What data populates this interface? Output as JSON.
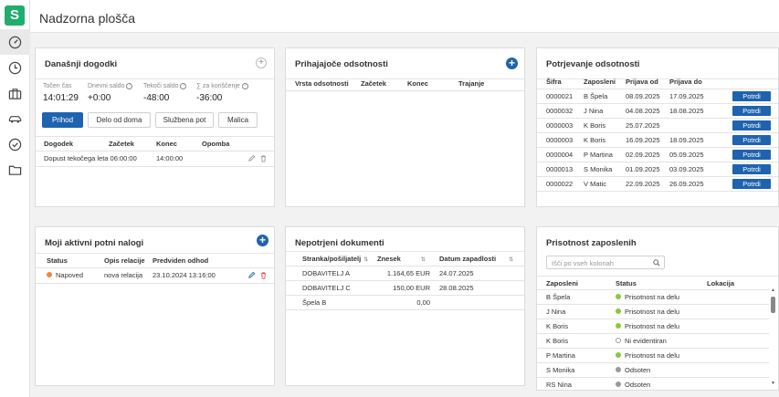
{
  "app": {
    "logo_letter": "S",
    "title": "Nadzorna plošča",
    "nav": [
      "dashboard-icon",
      "clock-icon",
      "briefcase-icon",
      "car-icon",
      "check-circle-icon",
      "folder-icon"
    ]
  },
  "todays_events": {
    "title": "Današnji dogodki",
    "stats": [
      {
        "label": "Točen čas",
        "value": "14:01:29"
      },
      {
        "label": "Dnevni saldo",
        "value": "+0:00"
      },
      {
        "label": "Tekoči saldo",
        "value": "-48:00"
      },
      {
        "label": "∑ za koriščenje",
        "value": "-36:00"
      }
    ],
    "buttons": [
      "Prihod",
      "Delo od doma",
      "Službena pot",
      "Malica"
    ],
    "columns": [
      "Dogodek",
      "Začetek",
      "Konec",
      "Opomba"
    ],
    "rows": [
      {
        "dogodek": "Dopust tekočega leta 06:00:00",
        "zacetek": "",
        "konec": "14:00:00",
        "opomba": ""
      }
    ]
  },
  "incoming_absences": {
    "title": "Prihajajoče odsotnosti",
    "columns": [
      "Vrsta odsotnosti",
      "Začetek",
      "Konec",
      "Trajanje"
    ]
  },
  "absence_confirmation": {
    "title": "Potrjevanje odsotnosti",
    "columns": [
      "Šifra",
      "Zaposleni",
      "Prijava od",
      "Prijava do"
    ],
    "button_label": "Potrdi",
    "rows": [
      {
        "sifra": "0000021",
        "zaposleni": "B Špela",
        "od": "08.09.2025",
        "do": "17.09.2025"
      },
      {
        "sifra": "0000032",
        "zaposleni": "J Nina",
        "od": "04.08.2025",
        "do": "18.08.2025"
      },
      {
        "sifra": "0000003",
        "zaposleni": "K Boris",
        "od": "25.07.2025",
        "do": ""
      },
      {
        "sifra": "0000003",
        "zaposleni": "K Boris",
        "od": "16.09.2025",
        "do": "18.09.2025"
      },
      {
        "sifra": "0000004",
        "zaposleni": "P Martina",
        "od": "02.09.2025",
        "do": "05.09.2025"
      },
      {
        "sifra": "0000013",
        "zaposleni": "S Monika",
        "od": "01.09.2025",
        "do": "03.09.2025"
      },
      {
        "sifra": "0000022",
        "zaposleni": "V Matic",
        "od": "22.09.2025",
        "do": "26.09.2025"
      }
    ]
  },
  "travel_orders": {
    "title": "Moji aktivni potni nalogi",
    "columns": [
      "Status",
      "Opis relacije",
      "Predviden odhod"
    ],
    "rows": [
      {
        "status": "Napoved",
        "status_color": "#f0883a",
        "opis": "nova relacija",
        "odhod": "23.10.2024 13:16:00"
      }
    ]
  },
  "unconfirmed_docs": {
    "title": "Nepotrjeni dokumenti",
    "columns": [
      "Stranka/pošiljatelj",
      "Znesek",
      "Datum zapadlosti"
    ],
    "rows": [
      {
        "stranka": "DOBAVITELJ A",
        "znesek": "1.164,65 EUR",
        "datum": "24.07.2025"
      },
      {
        "stranka": "DOBAVITELJ C",
        "znesek": "150,00 EUR",
        "datum": "28.08.2025"
      },
      {
        "stranka": "Špela B",
        "znesek": "0,00",
        "datum": ""
      }
    ]
  },
  "presence": {
    "title": "Prisotnost zaposlenih",
    "search_placeholder": "Išči po vseh kolonah",
    "columns": [
      "Zaposleni",
      "Status",
      "Lokacija"
    ],
    "rows": [
      {
        "zaposleni": "B Špela",
        "status": "Prisotnost na delu",
        "color": "#8cc63f",
        "hollow": false
      },
      {
        "zaposleni": "J Nina",
        "status": "Prisotnost na delu",
        "color": "#8cc63f",
        "hollow": false
      },
      {
        "zaposleni": "K Boris",
        "status": "Prisotnost na delu",
        "color": "#8cc63f",
        "hollow": false
      },
      {
        "zaposleni": "K Boris",
        "status": "Ni evidentiran",
        "color": "#9a9a9a",
        "hollow": true
      },
      {
        "zaposleni": "P Martina",
        "status": "Prisotnost na delu",
        "color": "#8cc63f",
        "hollow": false
      },
      {
        "zaposleni": "S Monika",
        "status": "Odsoten",
        "color": "#9a9a9a",
        "hollow": false
      },
      {
        "zaposleni": "RS Nina",
        "status": "Odsoten",
        "color": "#9a9a9a",
        "hollow": false
      }
    ]
  },
  "colors": {
    "accent": "#1e63b0",
    "brand": "#1fae6b"
  }
}
